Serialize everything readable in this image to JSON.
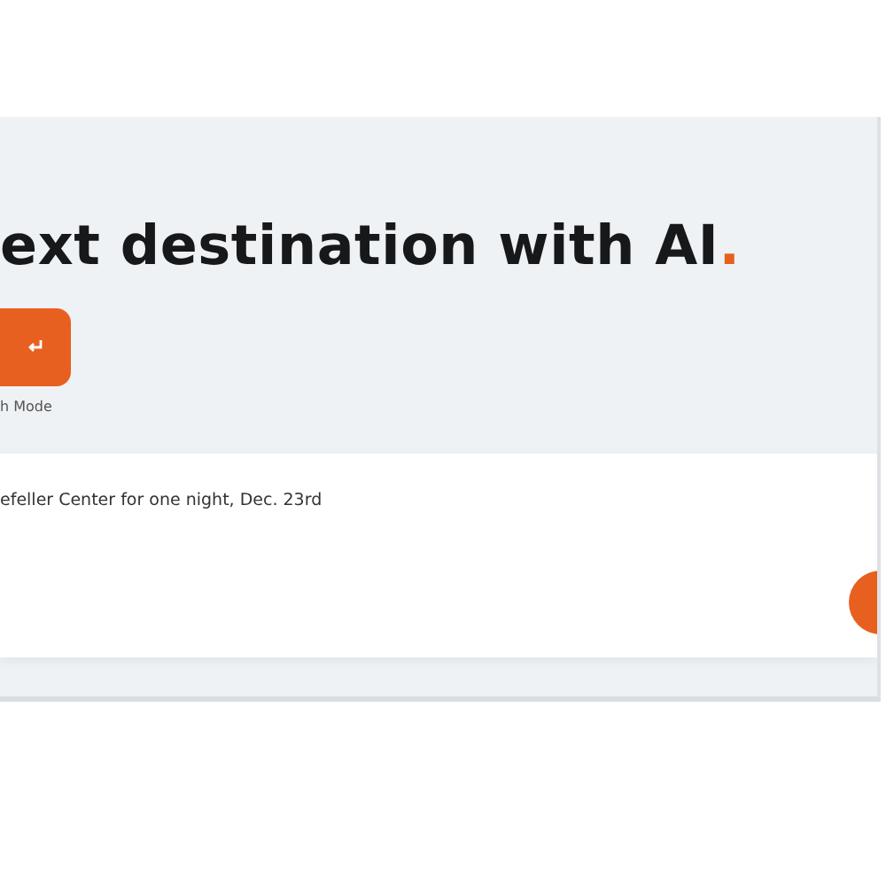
{
  "hero": {
    "heading": "ext destination with AI",
    "heading_end": "."
  },
  "mode_button": {
    "label": "h Mode"
  },
  "prompt": {
    "value": "efeller Center for one night, Dec. 23rd"
  }
}
